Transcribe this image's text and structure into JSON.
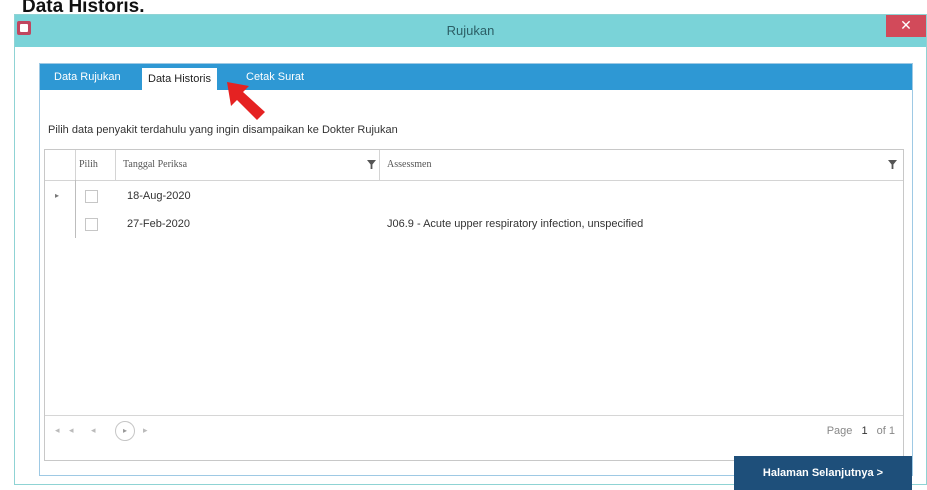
{
  "doc_heading": "Data Historis.",
  "window": {
    "title": "Rujukan",
    "close_glyph": "✕",
    "accent_color": "#2e98d4",
    "titlebar_color": "#7ad3d8",
    "close_color": "#d24a5a"
  },
  "tabs": [
    {
      "label": "Data Rujukan",
      "active": false
    },
    {
      "label": "Data Historis",
      "active": true
    },
    {
      "label": "Cetak Surat",
      "active": false
    }
  ],
  "instruction": "Pilih data penyakit terdahulu yang ingin disampaikan ke Dokter Rujukan",
  "grid": {
    "columns": [
      "Pilih",
      "Tanggal Periksa",
      "Assessmen"
    ],
    "rows": [
      {
        "pilih": false,
        "tanggal": "18-Aug-2020",
        "assessmen": ""
      },
      {
        "pilih": false,
        "tanggal": "27-Feb-2020",
        "assessmen": "J06.9 - Acute upper respiratory infection, unspecified"
      }
    ],
    "row_indicator": "▸"
  },
  "pager": {
    "first_glyph": "◂",
    "prev_glyph": "◂",
    "next_glyph": "▸",
    "last_glyph": "▸",
    "page_label": "Page",
    "page_number": "1",
    "of_label": "of 1"
  },
  "next_button_label": "Halaman Selanjutnya >",
  "annotation": {
    "icon": "red-arrow-icon",
    "color": "#e52222"
  }
}
